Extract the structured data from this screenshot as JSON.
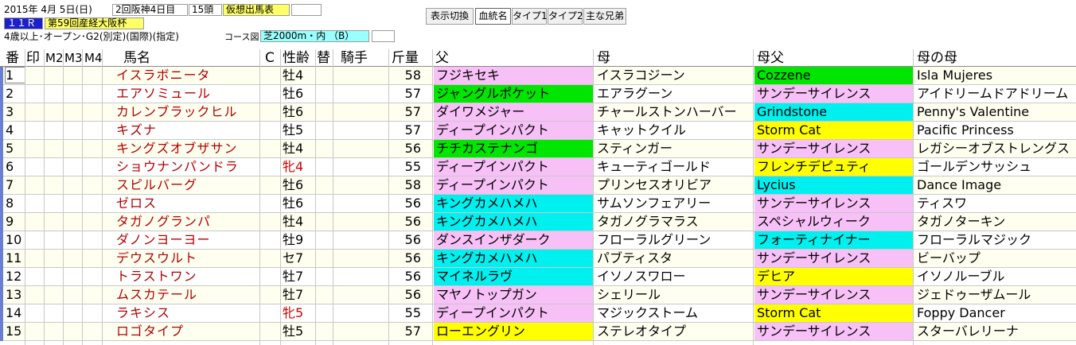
{
  "race_info": {
    "date": "2015年  4月  5日(日)",
    "meeting": "2回阪神4日目",
    "runners": "15頭",
    "mode_label": "仮想出馬表",
    "race_no": "１１Ｒ",
    "race_name": "第59回産経大阪杯",
    "conditions": "4歳以上･オープン･G2(別定)(国際)(指定)",
    "course_label": "コース図",
    "course": "芝2000m・内 （B）"
  },
  "toolbar": {
    "view_toggle": "表示切換",
    "tab_bloodline": "血統名",
    "tab_type1": "タイプ1",
    "tab_type2": "タイプ2",
    "tab_siblings": "主な兄弟"
  },
  "headers": {
    "no": "番",
    "mark": "印",
    "m2": "M2",
    "m3": "M3",
    "m4": "M4",
    "horse": "馬名",
    "c": "C",
    "sexage": "性齢",
    "change": "替",
    "jockey": "騎手",
    "weight": "斤量",
    "sire": "父",
    "dam": "母",
    "bms": "母父",
    "damdam": "母の母"
  },
  "colors": {
    "pink": "#f7c0f7",
    "green": "#00e600",
    "cyan": "#00f0f0",
    "yellow": "#ffff00",
    "horse_name": "#b00000"
  },
  "rows": [
    {
      "no": "1",
      "name": "イスラボニータ",
      "sexage": "牡4",
      "sex_red": false,
      "weight": "58",
      "sire": "フジキセキ",
      "sire_c": "pink",
      "dam": "イスラコジーン",
      "bms": "Cozzene",
      "bms_c": "green",
      "dd": "Isla Mujeres"
    },
    {
      "no": "2",
      "name": "エアソミュール",
      "sexage": "牡6",
      "sex_red": false,
      "weight": "57",
      "sire": "ジャングルポケット",
      "sire_c": "green",
      "dam": "エアラグーン",
      "bms": "サンデーサイレンス",
      "bms_c": "pink",
      "dd": "アイドリームドアドリーム"
    },
    {
      "no": "3",
      "name": "カレンブラックヒル",
      "sexage": "牡6",
      "sex_red": false,
      "weight": "57",
      "sire": "ダイワメジャー",
      "sire_c": "pink",
      "dam": "チャールストンハーバー",
      "bms": "Grindstone",
      "bms_c": "cya",
      "dd": "Penny's Valentine"
    },
    {
      "no": "4",
      "name": "キズナ",
      "sexage": "牡5",
      "sex_red": false,
      "weight": "57",
      "sire": "ディープインパクト",
      "sire_c": "pink",
      "dam": "キャットクイル",
      "bms": "Storm Cat",
      "bms_c": "yel",
      "dd": "Pacific Princess"
    },
    {
      "no": "5",
      "name": "キングズオブザサン",
      "sexage": "牡4",
      "sex_red": false,
      "weight": "56",
      "sire": "チチカステナンゴ",
      "sire_c": "green",
      "dam": "スティンガー",
      "bms": "サンデーサイレンス",
      "bms_c": "pink",
      "dd": "レガシーオブストレングス"
    },
    {
      "no": "6",
      "name": "ショウナンパンドラ",
      "sexage": "牝4",
      "sex_red": true,
      "weight": "55",
      "sire": "ディープインパクト",
      "sire_c": "pink",
      "dam": "キューティゴールド",
      "bms": "フレンチデピュティ",
      "bms_c": "yel",
      "dd": "ゴールデンサッシュ"
    },
    {
      "no": "7",
      "name": "スピルバーグ",
      "sexage": "牡6",
      "sex_red": false,
      "weight": "58",
      "sire": "ディープインパクト",
      "sire_c": "pink",
      "dam": "プリンセスオリビア",
      "bms": "Lycius",
      "bms_c": "cya",
      "dd": "Dance Image"
    },
    {
      "no": "8",
      "name": "ゼロス",
      "sexage": "牡6",
      "sex_red": false,
      "weight": "56",
      "sire": "キングカメハメハ",
      "sire_c": "cya",
      "dam": "サムソンフェアリー",
      "bms": "サンデーサイレンス",
      "bms_c": "pink",
      "dd": "ティスワ"
    },
    {
      "no": "9",
      "name": "タガノグランパ",
      "sexage": "牡4",
      "sex_red": false,
      "weight": "56",
      "sire": "キングカメハメハ",
      "sire_c": "cya",
      "dam": "タガノグラマラス",
      "bms": "スペシャルウィーク",
      "bms_c": "pink",
      "dd": "タガノターキン"
    },
    {
      "no": "10",
      "name": "ダノンヨーヨー",
      "sexage": "牡9",
      "sex_red": false,
      "weight": "56",
      "sire": "ダンスインザダーク",
      "sire_c": "pink",
      "dam": "フローラルグリーン",
      "bms": "フォーティナイナー",
      "bms_c": "cya",
      "dd": "フローラルマジック"
    },
    {
      "no": "11",
      "name": "デウスウルト",
      "sexage": "セ7",
      "sex_red": false,
      "weight": "56",
      "sire": "キングカメハメハ",
      "sire_c": "cya",
      "dam": "パブティスタ",
      "bms": "サンデーサイレンス",
      "bms_c": "pink",
      "dd": "ビーバップ"
    },
    {
      "no": "12",
      "name": "トラストワン",
      "sexage": "牡7",
      "sex_red": false,
      "weight": "56",
      "sire": "マイネルラヴ",
      "sire_c": "cya",
      "dam": "イソノスワロー",
      "bms": "デヒア",
      "bms_c": "yel",
      "dd": "イソノルーブル"
    },
    {
      "no": "13",
      "name": "ムスカテール",
      "sexage": "牡7",
      "sex_red": false,
      "weight": "56",
      "sire": "マヤノトップガン",
      "sire_c": "pink",
      "dam": "シェリール",
      "bms": "サンデーサイレンス",
      "bms_c": "pink",
      "dd": "ジェドゥーザムール"
    },
    {
      "no": "14",
      "name": "ラキシス",
      "sexage": "牝5",
      "sex_red": true,
      "weight": "55",
      "sire": "ディープインパクト",
      "sire_c": "pink",
      "dam": "マジックストーム",
      "bms": "Storm Cat",
      "bms_c": "yel",
      "dd": "Foppy Dancer"
    },
    {
      "no": "15",
      "name": "ロゴタイプ",
      "sexage": "牡5",
      "sex_red": false,
      "weight": "57",
      "sire": "ローエングリン",
      "sire_c": "yel",
      "dam": "ステレオタイプ",
      "bms": "サンデーサイレンス",
      "bms_c": "pink",
      "dd": "スターバレリーナ"
    }
  ]
}
